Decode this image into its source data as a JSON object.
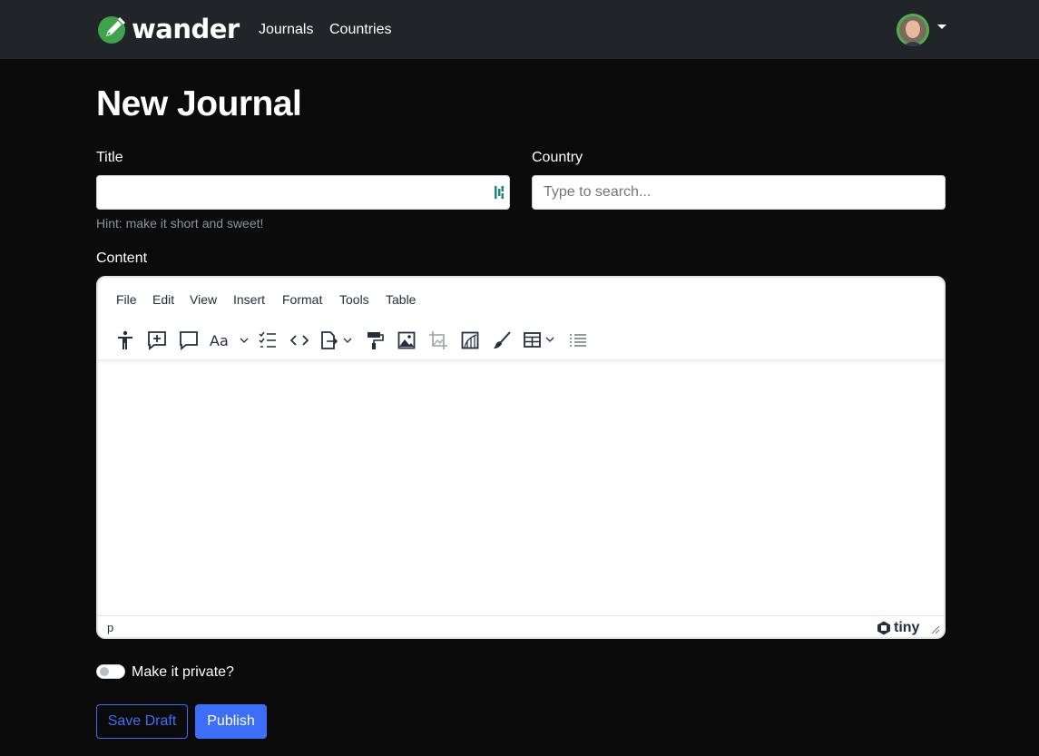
{
  "brand": {
    "name": "wander"
  },
  "nav": {
    "journals": "Journals",
    "countries": "Countries"
  },
  "page": {
    "title": "New Journal"
  },
  "form": {
    "title_label": "Title",
    "title_value": "",
    "title_hint": "Hint: make it short and sweet!",
    "country_label": "Country",
    "country_placeholder": "Type to search...",
    "content_label": "Content",
    "private_label": "Make it private?",
    "private_checked": false
  },
  "editor": {
    "menus": [
      "File",
      "Edit",
      "View",
      "Insert",
      "Format",
      "Tools",
      "Table"
    ],
    "toolbar_icons": [
      "accessibility-icon",
      "add-comment-icon",
      "comment-icon",
      "font-size-icon",
      "checklist-icon",
      "code-icon",
      "export-icon",
      "format-painter-icon",
      "image-icon",
      "crop-icon",
      "page-embed-icon",
      "brush-icon",
      "table-icon",
      "list-icon"
    ],
    "status_path": "p",
    "brand_text": "tiny"
  },
  "actions": {
    "save_draft": "Save Draft",
    "publish": "Publish"
  },
  "colors": {
    "accent": "#3d6ef7",
    "navbar": "#212529",
    "background": "#0b0b0c",
    "logo_green": "#3fa34d"
  }
}
